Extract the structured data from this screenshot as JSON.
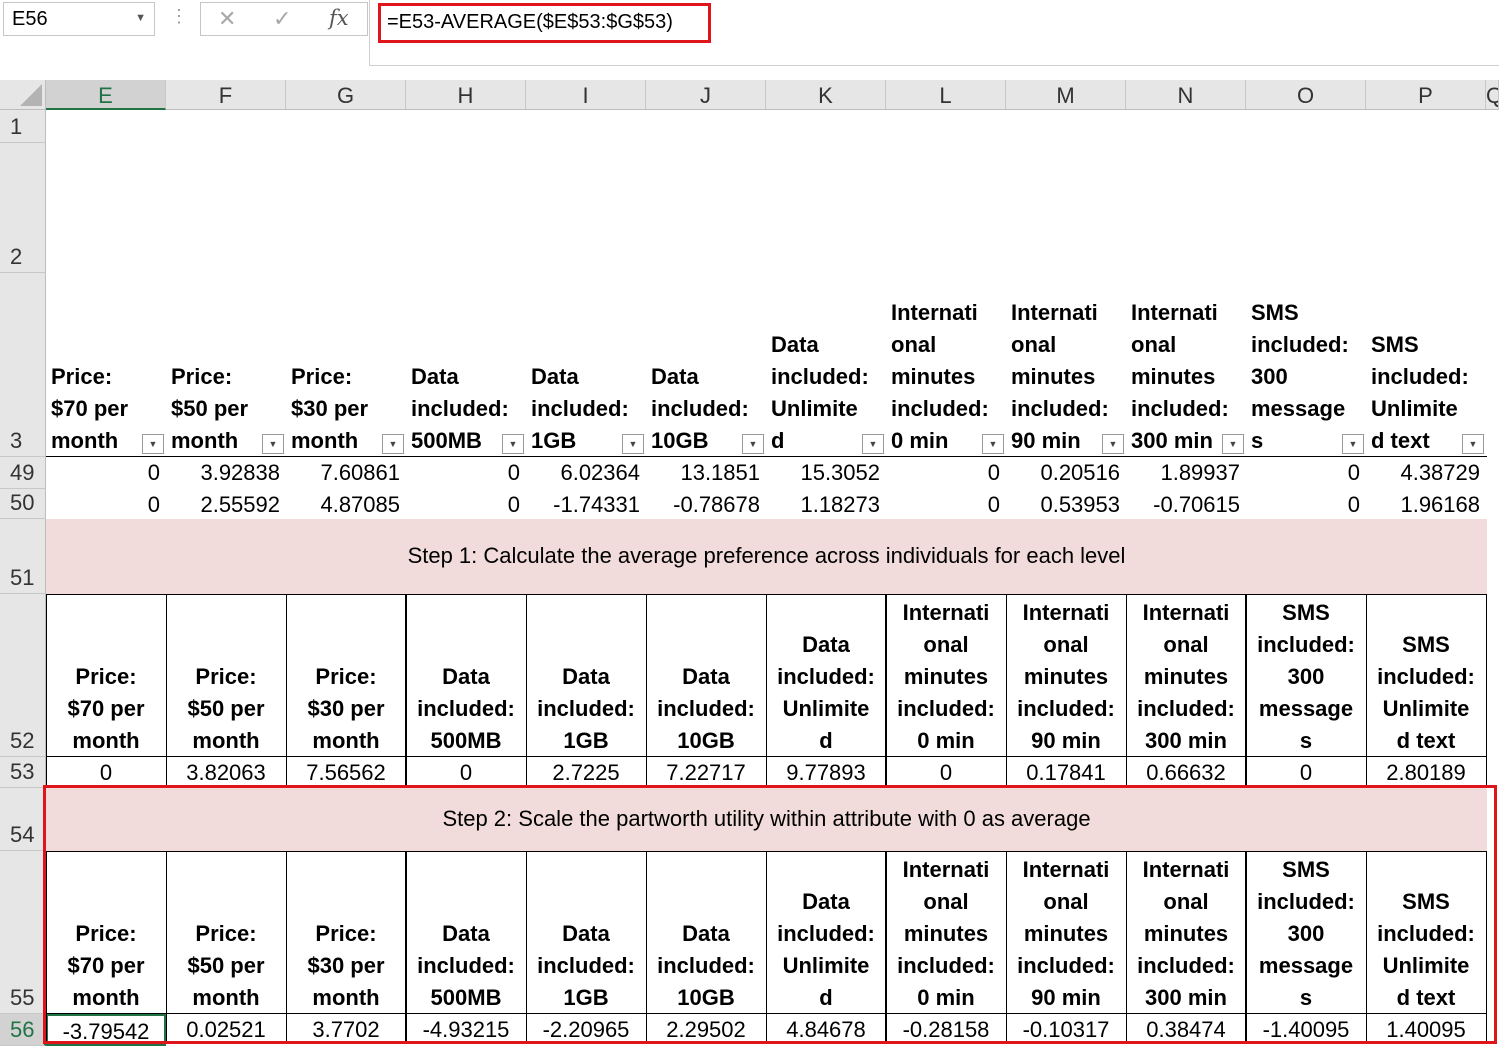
{
  "name_box": "E56",
  "formula": "=E53-AVERAGE($E$53:$G$53)",
  "formula_buttons": {
    "cancel": "✕",
    "enter": "✓",
    "fx": "fx"
  },
  "columns": [
    "E",
    "F",
    "G",
    "H",
    "I",
    "J",
    "K",
    "L",
    "M",
    "N",
    "O",
    "P",
    "Q"
  ],
  "selected_column": "E",
  "rows": [
    "1",
    "2",
    "3",
    "49",
    "50",
    "51",
    "52",
    "53",
    "54",
    "55",
    "56"
  ],
  "selected_row": "56",
  "header_lines": [
    [
      "Price:",
      "$70 per",
      "month"
    ],
    [
      "Price:",
      "$50 per",
      "month"
    ],
    [
      "Price:",
      "$30 per",
      "month"
    ],
    [
      "Data",
      "included:",
      "500MB"
    ],
    [
      "Data",
      "included:",
      "1GB"
    ],
    [
      "Data",
      "included:",
      "10GB"
    ],
    [
      "Data",
      "included:",
      "Unlimite",
      "d"
    ],
    [
      "Internati",
      "onal",
      "minutes",
      "included:",
      "0 min"
    ],
    [
      "Internati",
      "onal",
      "minutes",
      "included:",
      "90 min"
    ],
    [
      "Internati",
      "onal",
      "minutes",
      "included:",
      "300 min"
    ],
    [
      "SMS",
      "included:",
      "300",
      "message",
      "s"
    ],
    [
      "SMS",
      "included:",
      "Unlimite",
      "d text"
    ]
  ],
  "row49": [
    "0",
    "3.92838",
    "7.60861",
    "0",
    "6.02364",
    "13.1851",
    "15.3052",
    "0",
    "0.20516",
    "1.89937",
    "0",
    "4.38729"
  ],
  "row50": [
    "0",
    "2.55592",
    "4.87085",
    "0",
    "-1.74331",
    "-0.78678",
    "1.18273",
    "0",
    "0.53953",
    "-0.70615",
    "0",
    "1.96168"
  ],
  "step1": "Step 1: Calculate the average preference across individuals for each level",
  "row53": [
    "0",
    "3.82063",
    "7.56562",
    "0",
    "2.7225",
    "7.22717",
    "9.77893",
    "0",
    "0.17841",
    "0.66632",
    "0",
    "2.80189"
  ],
  "step2": "Step 2: Scale the partworth utility within attribute with 0 as average",
  "row56": [
    "-3.79542",
    "0.02521",
    "3.7702",
    "-4.93215",
    "-2.20965",
    "2.29502",
    "4.84678",
    "-0.28158",
    "-0.10317",
    "0.38474",
    "-1.40095",
    "1.40095"
  ]
}
